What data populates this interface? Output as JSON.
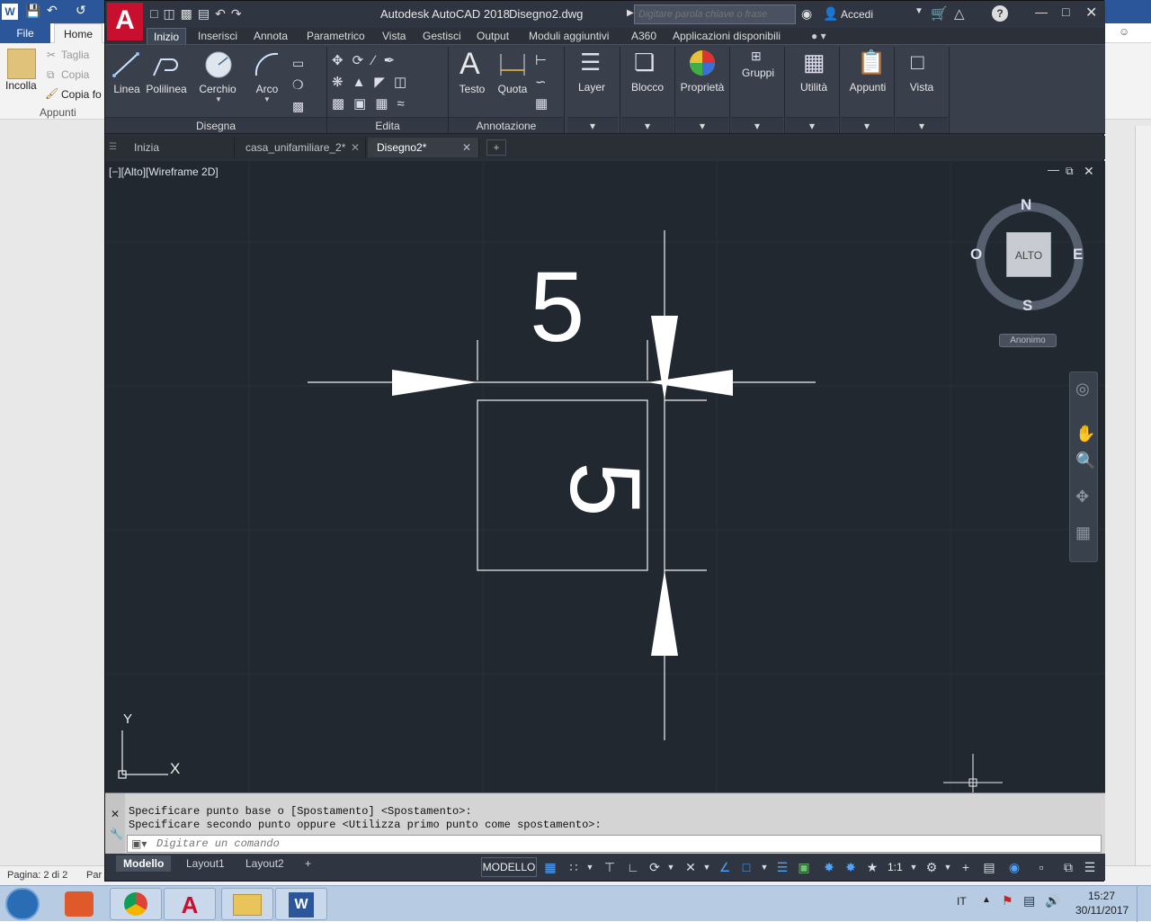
{
  "word": {
    "tabs": [
      "File",
      "Home"
    ],
    "clipboard": {
      "paste": "Incolla",
      "cut": "Taglia",
      "copy": "Copia",
      "format_painter": "Copia fo",
      "group": "Appunti"
    },
    "status": {
      "page": "Pagina: 2 di 2",
      "words": "Par"
    }
  },
  "acad": {
    "title": "Autodesk AutoCAD 2018",
    "filename": "Disegno2.dwg",
    "search_placeholder": "Digitare parola chiave o frase",
    "signin": "Accedi",
    "ribbon_tabs": [
      "Inizio",
      "Inserisci",
      "Annota",
      "Parametrico",
      "Vista",
      "Gestisci",
      "Output",
      "Moduli aggiuntivi",
      "A360",
      "Applicazioni disponibili"
    ],
    "tools": {
      "line": "Linea",
      "polyline": "Polilinea",
      "circle": "Cerchio",
      "arc": "Arco",
      "text": "Testo",
      "dimension": "Quota",
      "layer": "Layer",
      "block": "Blocco",
      "properties": "Proprietà",
      "groups": "Gruppi",
      "utilities": "Utilità",
      "clipboard": "Appunti",
      "view": "Vista"
    },
    "panels": {
      "draw": "Disegna",
      "modify": "Edita",
      "annotation": "Annotazione"
    },
    "file_tabs": [
      "Inizia",
      "casa_unifamiliare_2*",
      "Disegno2*"
    ],
    "viewport_label": "[−][Alto][Wireframe 2D]",
    "viewcube": {
      "n": "N",
      "s": "S",
      "e": "E",
      "w": "O",
      "face": "ALTO",
      "ucs": "Anonimo"
    },
    "drawing": {
      "dim_horizontal": "5",
      "dim_vertical": "5"
    },
    "ucs_axes": {
      "x": "X",
      "y": "Y"
    },
    "command_history": [
      "Specificare punto base o [Spostamento] <Spostamento>:",
      "Specificare secondo punto oppure <Utilizza primo punto come spostamento>:"
    ],
    "command_placeholder": "Digitare un comando",
    "layout_tabs": [
      "Modello",
      "Layout1",
      "Layout2"
    ],
    "status_mode": "MODELLO",
    "scale": "1:1"
  },
  "taskbar": {
    "language": "IT",
    "time": "15:27",
    "date": "30/11/2017"
  }
}
